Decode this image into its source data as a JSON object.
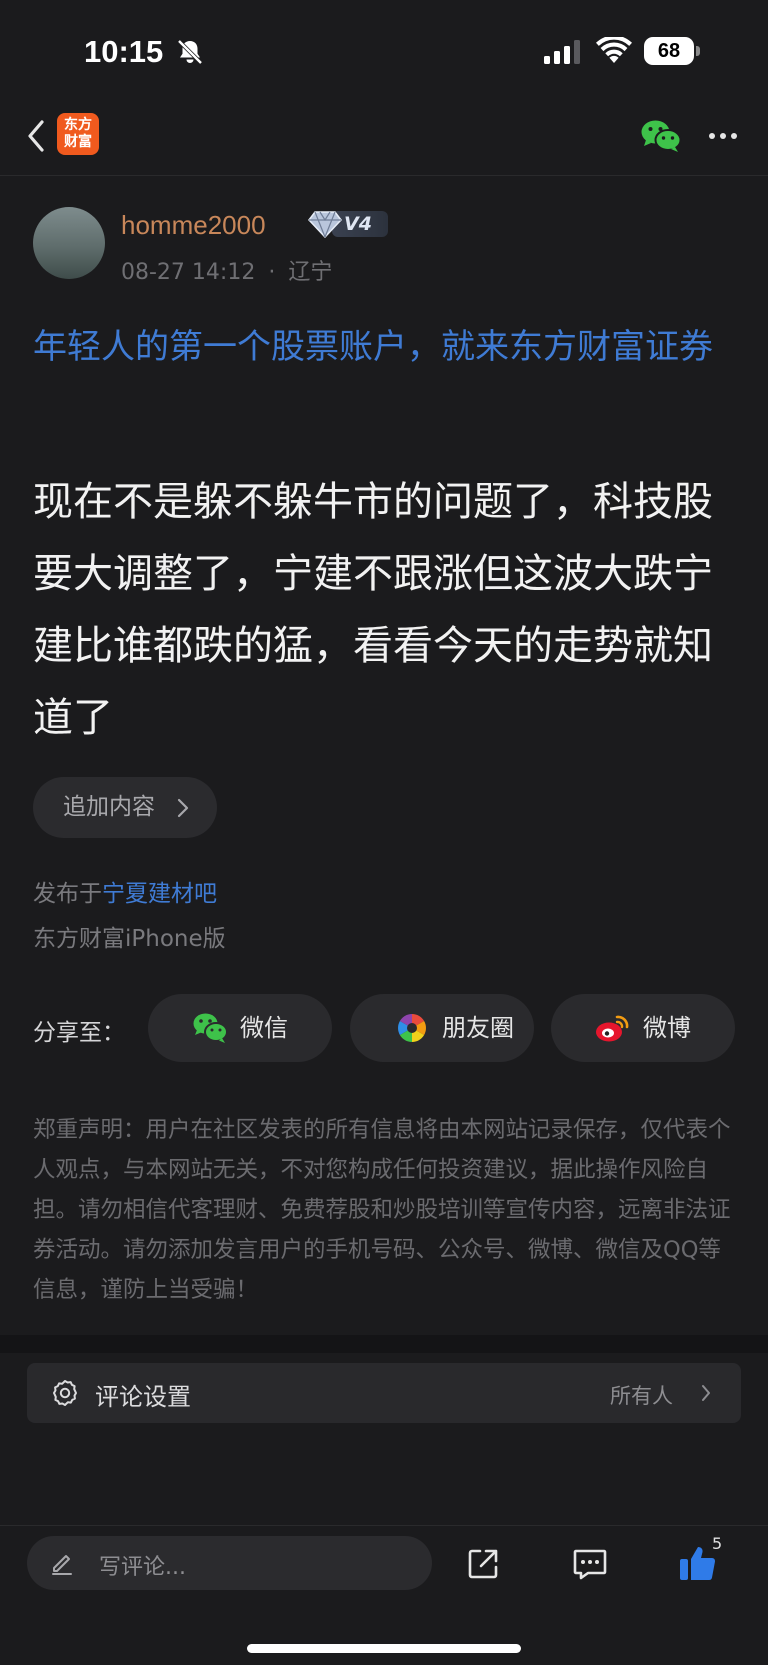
{
  "status_bar": {
    "time": "10:15",
    "battery": "68"
  },
  "nav": {
    "logo_line1": "东方",
    "logo_line2": "财富"
  },
  "author": {
    "username": "homme2000",
    "level": "V4",
    "date": "08-27 14:12",
    "location": "辽宁",
    "meta_separator": "·"
  },
  "post": {
    "promo_title": "年轻人的第一个股票账户，就来东方财富证券",
    "body": "现在不是躲不躲牛市的问题了，科技股要大调整了，宁建不跟涨但这波大跌宁建比谁都跌的猛，看看今天的走势就知道了",
    "add_content_label": "追加内容",
    "published_prefix": "发布于",
    "forum_name": "宁夏建材吧",
    "client": "东方财富iPhone版"
  },
  "share": {
    "label": "分享至：",
    "wechat": "微信",
    "moments": "朋友圈",
    "weibo": "微博"
  },
  "disclaimer": "郑重声明：用户在社区发表的所有信息将由本网站记录保存，仅代表个人观点，与本网站无关，不对您构成任何投资建议，据此操作风险自担。请勿相信代客理财、免费荐股和炒股培训等宣传内容，远离非法证券活动。请勿添加发言用户的手机号码、公众号、微博、微信及QQ等信息，谨防上当受骗！",
  "comment_settings": {
    "label": "评论设置",
    "value": "所有人"
  },
  "bottom_bar": {
    "comment_placeholder": "写评论...",
    "like_count": "5"
  },
  "colors": {
    "background": "#1b1b1d",
    "link_blue": "#3f7bd4",
    "username_orange": "#c8875a",
    "logo_orange": "#f05a1e",
    "like_blue": "#2f7be8",
    "wechat_green": "#3ec24a"
  }
}
